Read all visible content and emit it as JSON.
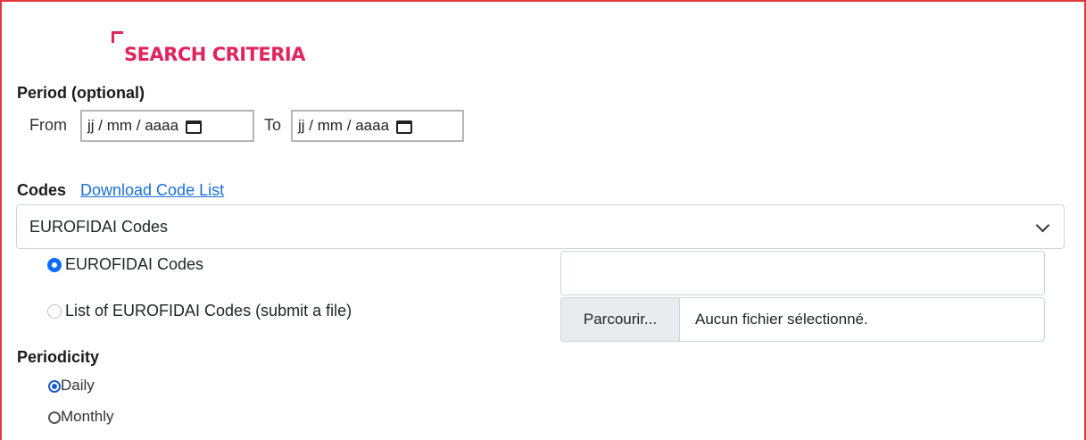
{
  "section": {
    "title": "SEARCH CRITERIA"
  },
  "period": {
    "label": "Period (optional)",
    "from_label": "From",
    "from_value": "jj / mm / aaaa",
    "to_label": "To",
    "to_value": "jj / mm / aaaa"
  },
  "codes": {
    "label": "Codes",
    "download_link": "Download Code List",
    "select_value": "EUROFIDAI Codes",
    "options": [
      {
        "label": "EUROFIDAI Codes",
        "selected": true
      },
      {
        "label": "List of EUROFIDAI Codes (submit a file)",
        "selected": false
      }
    ],
    "text_input_value": "",
    "file": {
      "button": "Parcourir...",
      "status": "Aucun fichier sélectionné."
    }
  },
  "periodicity": {
    "label": "Periodicity",
    "options": [
      {
        "label": "Daily",
        "selected": true
      },
      {
        "label": "Monthly",
        "selected": false
      }
    ]
  },
  "colors": {
    "accent": "#e0245e",
    "frame": "#e23a3a",
    "link": "#1a6fd8",
    "radio": "#0d6efd"
  }
}
